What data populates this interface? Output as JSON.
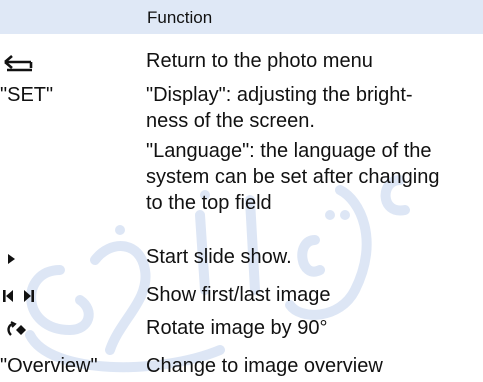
{
  "header": {
    "function_label": "Function"
  },
  "rows": [
    {
      "key_icon": "return-arrow-icon",
      "description": "Return to the photo menu"
    },
    {
      "key_text": "\"SET\"",
      "description_lines": [
        "\"Display\": adjusting the bright-",
        "ness of the screen.",
        "\"Language\": the language of the",
        "system can be set after changing",
        "to the top field"
      ]
    },
    {
      "key_icon": "play-icon",
      "description": "Start slide show."
    },
    {
      "key_icon": "first-last-icon",
      "description": "Show first/last image"
    },
    {
      "key_icon": "rotate-icon",
      "description": "Rotate image by 90°"
    },
    {
      "key_text": "\"Overview\"",
      "description": "Change to image overview"
    }
  ],
  "colors": {
    "header_bg": "#dfe8f6",
    "watermark": "#c9d8f0"
  }
}
